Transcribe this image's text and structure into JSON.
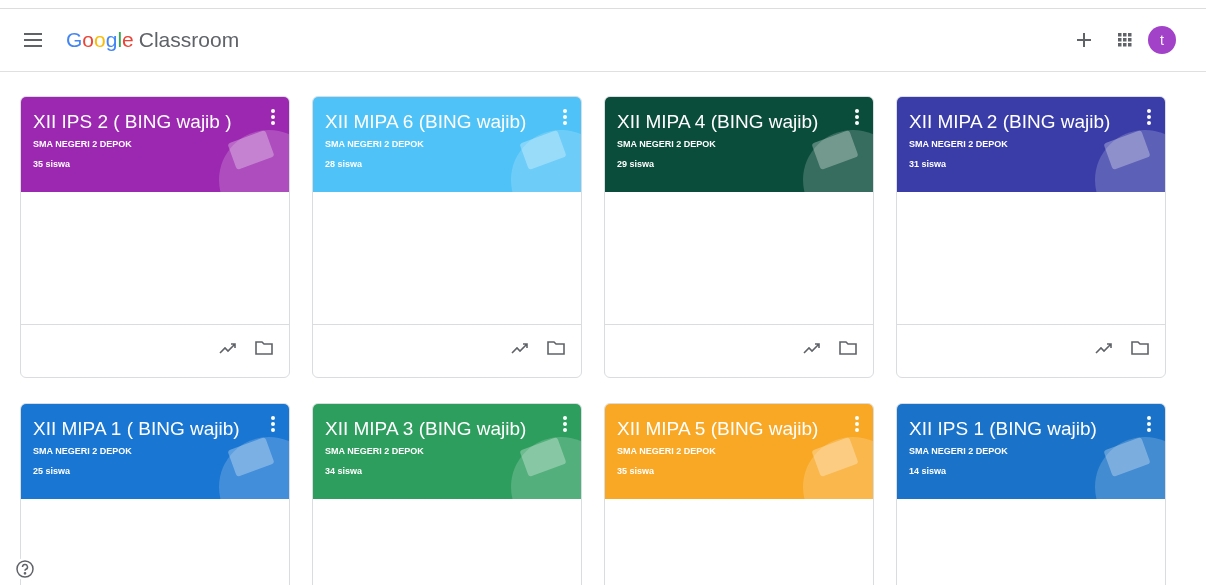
{
  "header": {
    "logo_brand": "Google",
    "logo_product": "Classroom",
    "avatar_initial": "t"
  },
  "classes": [
    {
      "title": "XII IPS 2 ( BING wajib )",
      "school": "SMA NEGERI 2 DEPOK",
      "students": "35 siswa",
      "color": "#9c27b0"
    },
    {
      "title": "XII MIPA 6 (BING wajib)",
      "school": "SMA NEGERI 2 DEPOK",
      "students": "28 siswa",
      "color": "#4fc3f7"
    },
    {
      "title": "XII MIPA 4 (BING wajib)",
      "school": "SMA NEGERI 2 DEPOK",
      "students": "29 siswa",
      "color": "#0b4d3b"
    },
    {
      "title": "XII MIPA 2 (BING wajib)",
      "school": "SMA NEGERI 2 DEPOK",
      "students": "31 siswa",
      "color": "#3a3da8"
    },
    {
      "title": "XII MIPA 1 ( BING wajib)",
      "school": "SMA NEGERI 2 DEPOK",
      "students": "25 siswa",
      "color": "#1976d2"
    },
    {
      "title": "XII MIPA 3 (BING wajib)",
      "school": "SMA NEGERI 2 DEPOK",
      "students": "34 siswa",
      "color": "#2e9e5e"
    },
    {
      "title": "XII MIPA 5 (BING wajib)",
      "school": "SMA NEGERI 2 DEPOK",
      "students": "35 siswa",
      "color": "#f9a825"
    },
    {
      "title": "XII IPS 1 (BING wajib)",
      "school": "SMA NEGERI 2 DEPOK",
      "students": "14 siswa",
      "color": "#1a73c8"
    }
  ]
}
